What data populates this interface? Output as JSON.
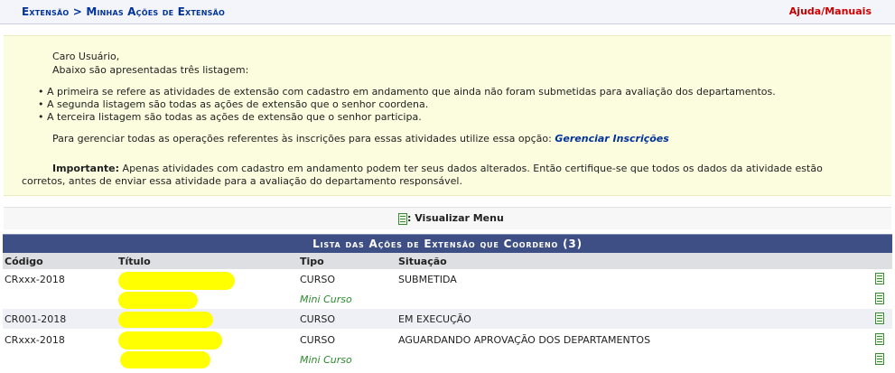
{
  "header": {
    "breadcrumb": "Extensão > Minhas Ações de Extensão",
    "help_link": "Ajuda/Manuais"
  },
  "info": {
    "greeting": "Caro Usuário,",
    "intro": "Abaixo são apresentadas três listagem:",
    "bullets": [
      "A primeira se refere as atividades de extensão com cadastro em andamento que ainda não foram submetidas para avaliação dos departamentos.",
      "A segunda listagem são todas as ações de extensão que o senhor coordena.",
      "A terceira listagem são todas as ações de extensão que o senhor participa."
    ],
    "manage_text": "Para gerenciar todas as operações referentes às inscrições para essas atividades utilize essa opção:",
    "manage_link": "Gerenciar Inscrições",
    "important_label": "Importante:",
    "important_text_1": "Apenas atividades com cadastro em andamento podem ter seus dados alterados. Então certifique-se que todos os dados da atividade estão",
    "important_text_2": "corretos, antes de enviar essa atividade para a avaliação do departamento responsável."
  },
  "menu": {
    "label": ": Visualizar Menu",
    "icon": "document-icon"
  },
  "table": {
    "title": "Lista das Ações de Extensão que Coordeno (3)",
    "columns": [
      "Código",
      "Título",
      "Tipo",
      "Situação"
    ],
    "rows": [
      {
        "codigo": "CRxxx-2018",
        "tipo": "CURSO",
        "situacao": "SUBMETIDA",
        "subtipo": "Mini Curso"
      },
      {
        "codigo": "CR001-2018",
        "tipo": "CURSO",
        "situacao": "EM EXECUÇÃO",
        "subtipo": ""
      },
      {
        "codigo": "CRxxx-2018",
        "tipo": "CURSO",
        "situacao": "AGUARDANDO APROVAÇÃO DOS DEPARTAMENTOS",
        "subtipo": "Mini Curso"
      }
    ]
  },
  "colors": {
    "breadcrumb": "#003399",
    "help_link": "#cc0000",
    "info_background": "#fcfcde",
    "table_header": "#3e4f86",
    "redaction": "#ffff00",
    "subtype": "#2e8b2e"
  }
}
